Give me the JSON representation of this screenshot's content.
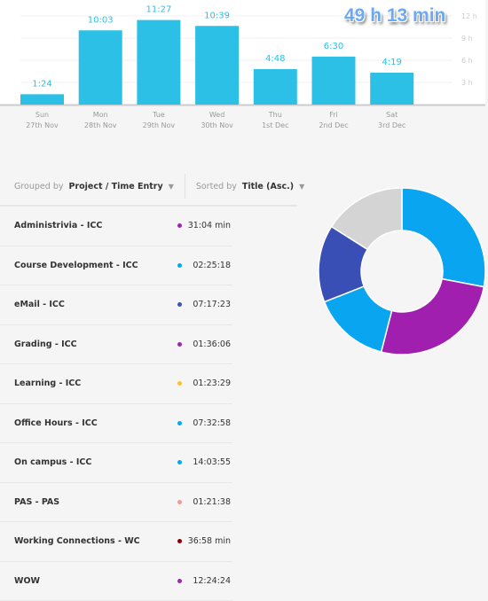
{
  "total": "49 h 13 min",
  "chart_data": {
    "type": "bar",
    "categories": [
      "Sun 27th Nov",
      "Mon 28th Nov",
      "Tue 29th Nov",
      "Wed 30th Nov",
      "Thu 1st Dec",
      "Fri 2nd Dec",
      "Sat 3rd Dec"
    ],
    "days": [
      "Sun",
      "Mon",
      "Tue",
      "Wed",
      "Thu",
      "Fri",
      "Sat"
    ],
    "dates": [
      "27th Nov",
      "28th Nov",
      "29th Nov",
      "30th Nov",
      "1st Dec",
      "2nd Dec",
      "3rd Dec"
    ],
    "labels": [
      "1:24",
      "10:03",
      "11:27",
      "10:39",
      "4:48",
      "6:30",
      "4:19"
    ],
    "values": [
      1.4,
      10.05,
      11.45,
      10.65,
      4.8,
      6.5,
      4.317
    ],
    "yticks": [
      "3 h",
      "6 h",
      "9 h",
      "12 h"
    ],
    "ytick_values": [
      3,
      6,
      9,
      12
    ],
    "ylim": [
      0,
      12.5
    ],
    "color": "#2cc0e6",
    "grid": true
  },
  "controls": {
    "grouped_prefix": "Grouped by",
    "grouped_value": "Project / Time Entry",
    "sorted_prefix": "Sorted by",
    "sorted_value": "Title (Asc.)"
  },
  "entries": [
    {
      "title": "Administrivia - ICC",
      "time": "31:04 min",
      "color": "#9c27b0"
    },
    {
      "title": "Course Development - ICC",
      "time": "02:25:18",
      "color": "#03a9f4"
    },
    {
      "title": "eMail - ICC",
      "time": "07:17:23",
      "color": "#3f51b5"
    },
    {
      "title": "Grading - ICC",
      "time": "01:36:06",
      "color": "#9c27b0"
    },
    {
      "title": "Learning - ICC",
      "time": "01:23:29",
      "color": "#fbc02d"
    },
    {
      "title": "Office Hours - ICC",
      "time": "07:32:58",
      "color": "#03a9f4"
    },
    {
      "title": "On campus - ICC",
      "time": "14:03:55",
      "color": "#03a9f4"
    },
    {
      "title": "PAS - PAS",
      "time": "01:21:38",
      "color": "#ef9a9a"
    },
    {
      "title": "Working Connections - WC",
      "time": "36:58 min",
      "color": "#8b0000"
    },
    {
      "title": "WOW",
      "time": "12:24:24",
      "color": "#9c27b0"
    }
  ],
  "donut": [
    {
      "color": "#0aa5f0",
      "value": 28
    },
    {
      "color": "#a11fae",
      "value": 26
    },
    {
      "color": "#0aa5f0",
      "value": 15
    },
    {
      "color": "#3a4fb5",
      "value": 15
    },
    {
      "color": "#d4d4d4",
      "value": 16
    }
  ]
}
